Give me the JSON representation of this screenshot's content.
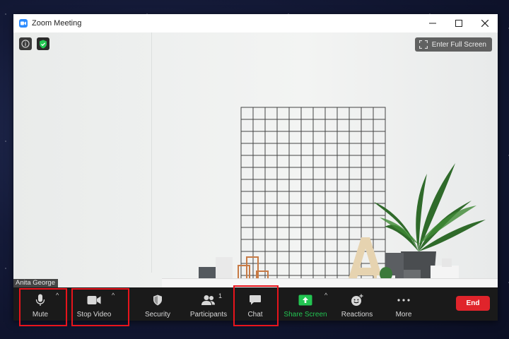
{
  "window": {
    "title": "Zoom Meeting",
    "controls": [
      "minimize",
      "maximize",
      "close"
    ]
  },
  "video": {
    "participant_name": "Anita George",
    "fullscreen_label": "Enter Full Screen"
  },
  "toolbar": {
    "mute_label": "Mute",
    "stop_video_label": "Stop Video",
    "security_label": "Security",
    "participants_label": "Participants",
    "participants_count": "1",
    "chat_label": "Chat",
    "share_screen_label": "Share Screen",
    "reactions_label": "Reactions",
    "more_label": "More",
    "end_label": "End"
  },
  "colors": {
    "accent_blue": "#2d8cff",
    "share_green": "#23c552",
    "end_red": "#e0242b",
    "highlight_red": "#e8141c",
    "toolbar_bg": "#1a1a1a"
  }
}
